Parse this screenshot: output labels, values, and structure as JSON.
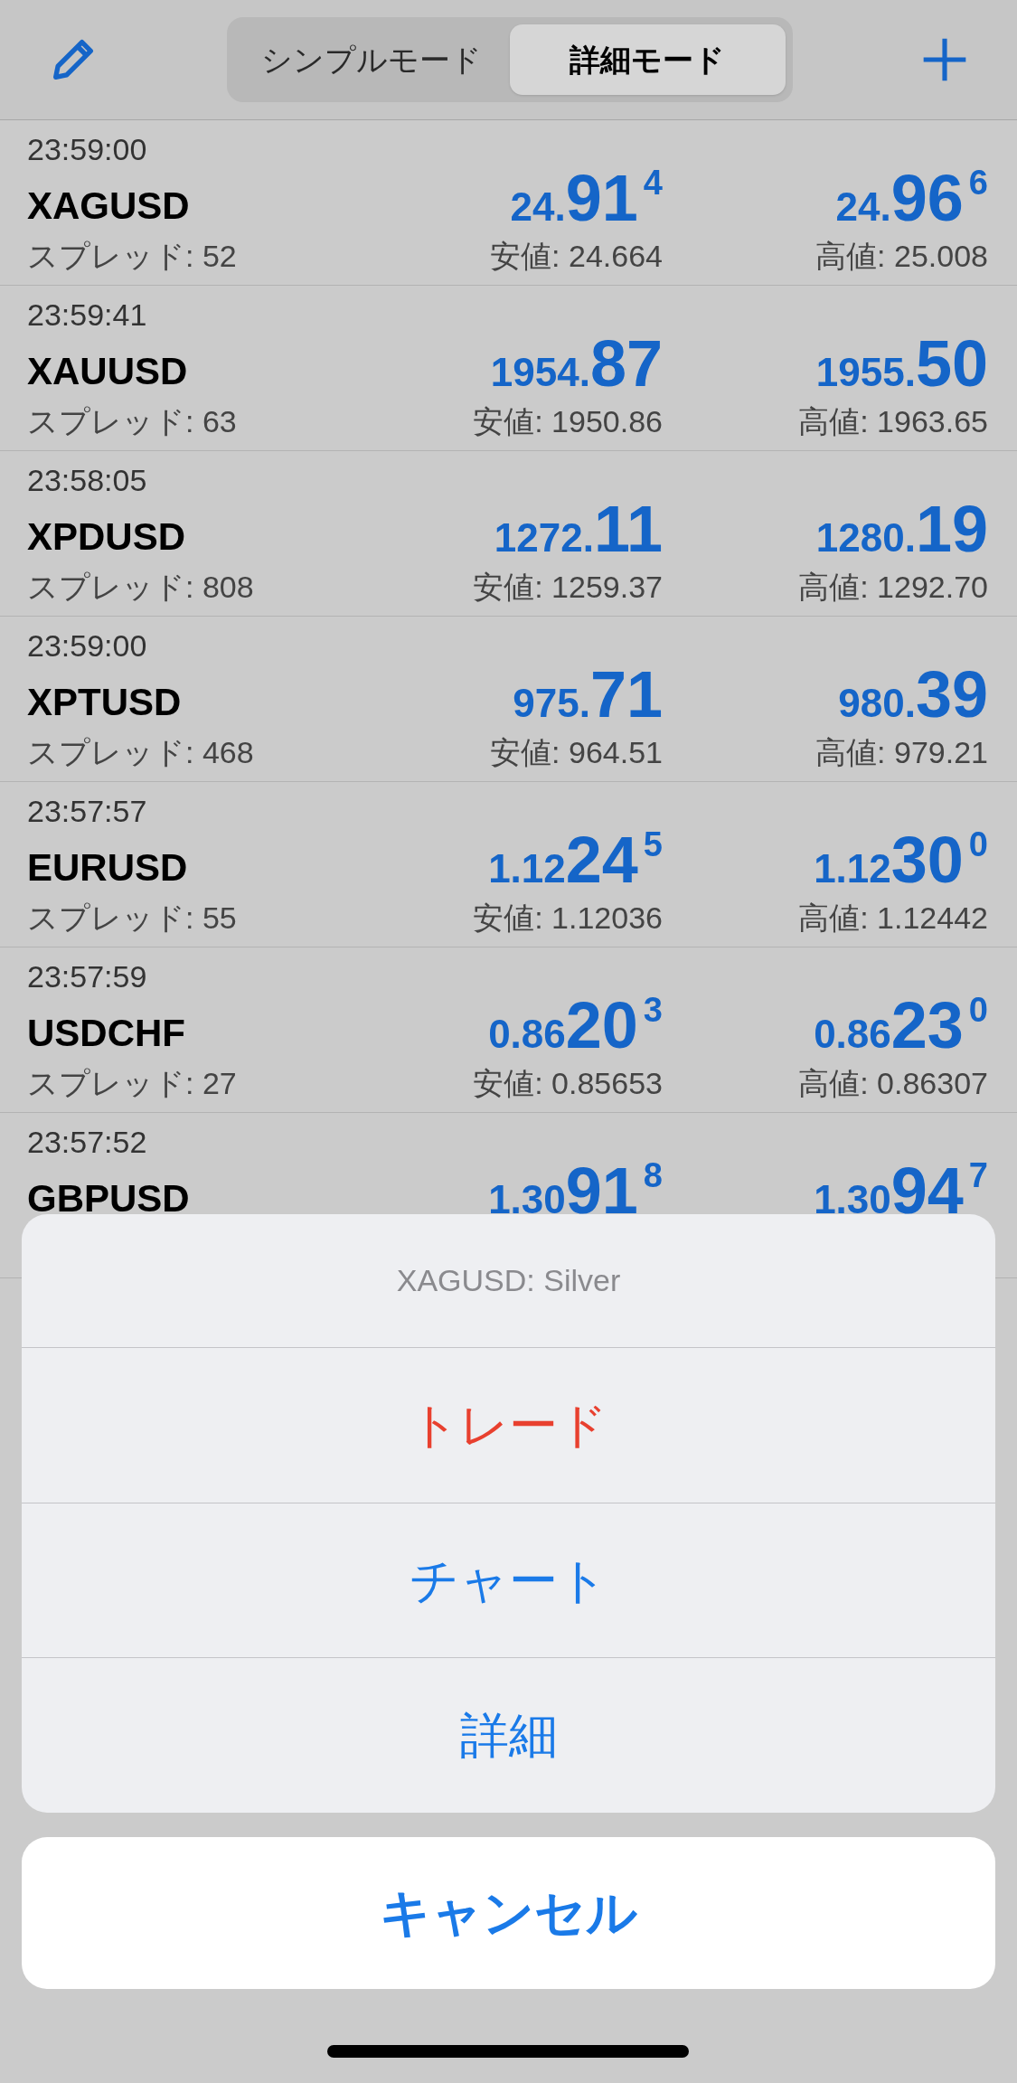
{
  "toolbar": {
    "tabs": [
      {
        "label": "シンプルモード",
        "selected": false
      },
      {
        "label": "詳細モード",
        "selected": true
      }
    ]
  },
  "quotes": [
    {
      "time": "23:59:00",
      "symbol": "XAGUSD",
      "bid": {
        "prefix": "24.",
        "big": "91",
        "pip": "4"
      },
      "ask": {
        "prefix": "24.",
        "big": "96",
        "pip": "6"
      },
      "spread": "スプレッド: 52",
      "low": "安値: 24.664",
      "high": "高値: 25.008"
    },
    {
      "time": "23:59:41",
      "symbol": "XAUUSD",
      "bid": {
        "prefix": "1954.",
        "big": "87"
      },
      "ask": {
        "prefix": "1955.",
        "big": "50"
      },
      "spread": "スプレッド: 63",
      "low": "安値: 1950.86",
      "high": "高値: 1963.65"
    },
    {
      "time": "23:58:05",
      "symbol": "XPDUSD",
      "bid": {
        "prefix": "1272.",
        "big": "11"
      },
      "ask": {
        "prefix": "1280.",
        "big": "19"
      },
      "spread": "スプレッド: 808",
      "low": "安値: 1259.37",
      "high": "高値: 1292.70"
    },
    {
      "time": "23:59:00",
      "symbol": "XPTUSD",
      "bid": {
        "prefix": "975.",
        "big": "71"
      },
      "ask": {
        "prefix": "980.",
        "big": "39"
      },
      "spread": "スプレッド: 468",
      "low": "安値: 964.51",
      "high": "高値: 979.21"
    },
    {
      "time": "23:57:57",
      "symbol": "EURUSD",
      "bid": {
        "prefix": "1.12",
        "big": "24",
        "pip": "5"
      },
      "ask": {
        "prefix": "1.12",
        "big": "30",
        "pip": "0"
      },
      "spread": "スプレッド: 55",
      "low": "安値: 1.12036",
      "high": "高値: 1.12442"
    },
    {
      "time": "23:57:59",
      "symbol": "USDCHF",
      "bid": {
        "prefix": "0.86",
        "big": "20",
        "pip": "3"
      },
      "ask": {
        "prefix": "0.86",
        "big": "23",
        "pip": "0"
      },
      "spread": "スプレッド: 27",
      "low": "安値: 0.85653",
      "high": "高値: 0.86307"
    },
    {
      "time": "23:57:52",
      "symbol": "GBPUSD",
      "bid": {
        "prefix": "1.30",
        "big": "91",
        "pip": "8"
      },
      "ask": {
        "prefix": "1.30",
        "big": "94",
        "pip": "7"
      }
    }
  ],
  "action_sheet": {
    "title": "XAGUSD: Silver",
    "actions": [
      {
        "label": "トレード",
        "kind": "destructive"
      },
      {
        "label": "チャート",
        "kind": "default"
      },
      {
        "label": "詳細",
        "kind": "default"
      }
    ],
    "cancel": "キャンセル"
  }
}
